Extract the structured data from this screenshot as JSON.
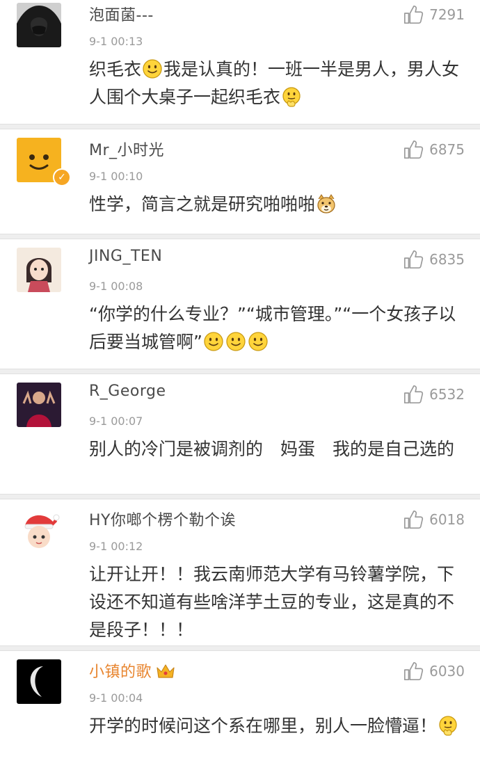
{
  "comments": [
    {
      "username": "泡面菌---",
      "time": "9-1 00:13",
      "likes": "7291",
      "text_parts": [
        "织毛衣",
        "我是认真的！一班一半是男人，男人女人围个大桌子一起织毛衣"
      ]
    },
    {
      "username": "Mr_小时光",
      "time": "9-1 00:10",
      "likes": "6875",
      "text_parts": [
        "性学，简言之就是研究啪啪啪"
      ]
    },
    {
      "username": "JING_TEN",
      "time": "9-1 00:08",
      "likes": "6835",
      "text_parts": [
        "“你学的什么专业？”“城市管理。”“一个女孩子以后要当城管啊”"
      ]
    },
    {
      "username": "R_George",
      "time": "9-1 00:07",
      "likes": "6532",
      "text_parts": [
        "别人的冷门是被调剂的　妈蛋　我的是自己选的"
      ]
    },
    {
      "username": "HY你啷个楞个勒个诶",
      "time": "9-1 00:12",
      "likes": "6018",
      "text_parts": [
        "让开让开！！我云南师范大学有马铃薯学院，下设还不知道有些啥洋芋土豆的专业，这是真的不是段子！！！"
      ]
    },
    {
      "username": "小镇的歌",
      "time": "9-1 00:04",
      "likes": "6030",
      "text_parts": [
        "开学的时候问这个系在哪里，别人一脸懵逼！"
      ]
    }
  ],
  "icons": {
    "like": "thumbs-up-icon",
    "emoji_smile": "smile-emoji-icon",
    "emoji_hand": "thinking-emoji-icon",
    "emoji_doge": "doge-emoji-icon",
    "verified": "verified-badge-icon",
    "crown": "crown-icon"
  },
  "colors": {
    "username": "#4a4a4a",
    "vip_username": "#e8852f",
    "meta": "#9a9a9a",
    "text": "#333333",
    "separator": "#eeeeee",
    "verified_badge": "#f6a623"
  }
}
